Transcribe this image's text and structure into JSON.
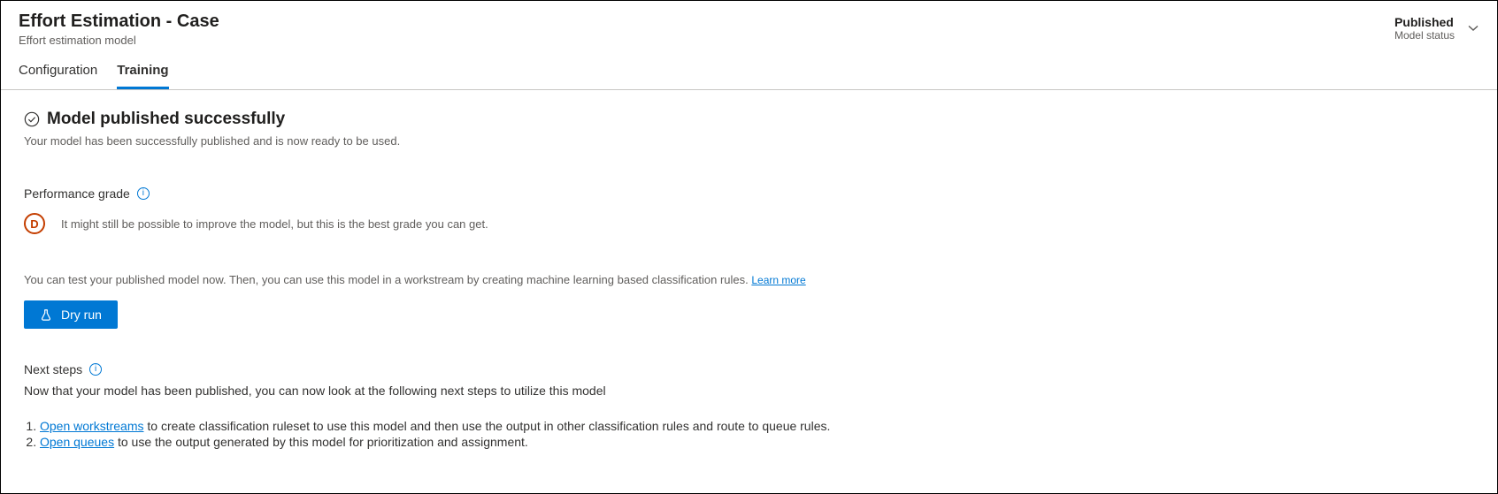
{
  "header": {
    "title": "Effort Estimation - Case",
    "subtitle": "Effort estimation model",
    "status_value": "Published",
    "status_label": "Model status"
  },
  "tabs": {
    "configuration": "Configuration",
    "training": "Training"
  },
  "success": {
    "title": "Model published successfully",
    "subtitle": "Your model has been successfully published and is now ready to be used."
  },
  "performance": {
    "label": "Performance grade",
    "grade_letter": "D",
    "grade_text": "It might still be possible to improve the model, but this is the best grade you can get."
  },
  "test": {
    "text": "You can test your published model now. Then, you can use this model in a workstream by creating machine learning based classification rules. ",
    "learn_more": "Learn more"
  },
  "buttons": {
    "dry_run": "Dry run"
  },
  "next_steps": {
    "label": "Next steps",
    "desc": "Now that your model has been published, you can now look at the following next steps to utilize this model",
    "items": [
      {
        "link": "Open workstreams",
        "rest": " to create classification ruleset to use this model and then use the output in other classification rules and route to queue rules."
      },
      {
        "link": "Open queues",
        "rest": " to use the output generated by this model for prioritization and assignment."
      }
    ]
  }
}
